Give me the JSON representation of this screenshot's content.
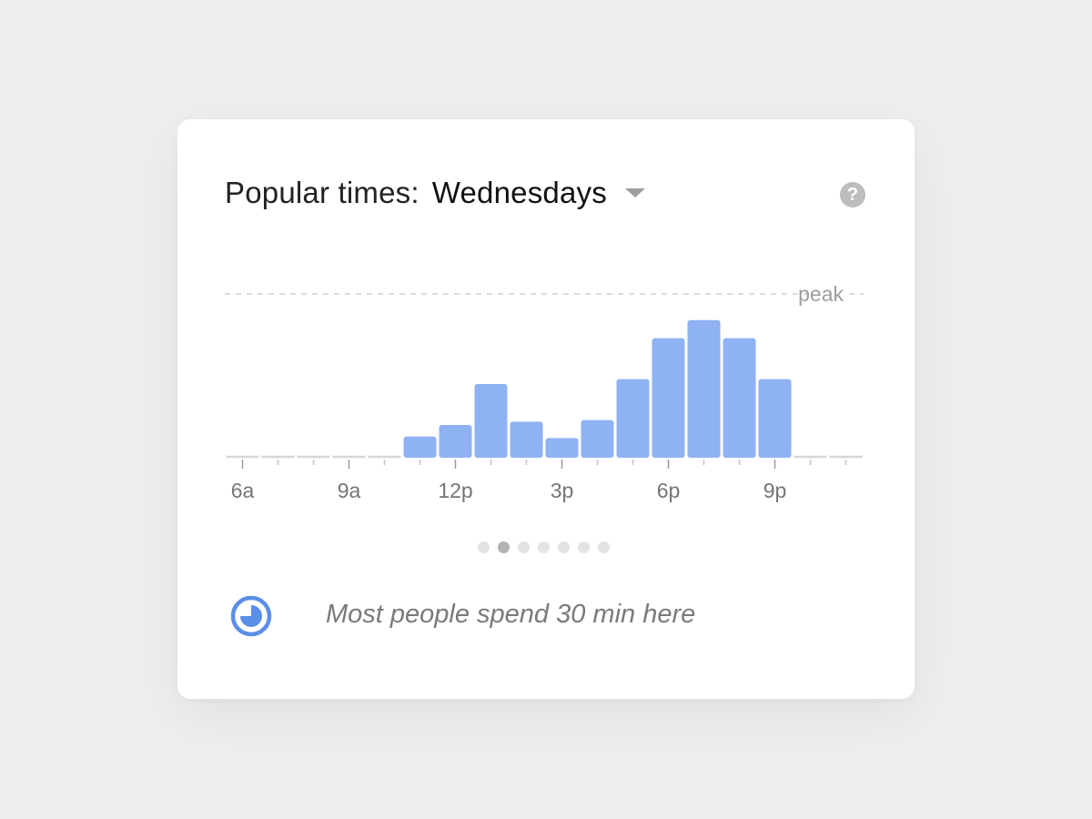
{
  "card": {
    "title_label": "Popular times:",
    "day": "Wednesdays",
    "caret_icon": "caret-down-icon",
    "help_icon": "help-circle-icon",
    "help_glyph": "?",
    "footer_icon": "clock-icon",
    "footer_text": "Most people spend 30 min here",
    "pager": {
      "count": 7,
      "active_index": 1
    }
  },
  "colors": {
    "bar": "#8fb2f2",
    "baseline": "#d6d6d6",
    "peak_line": "#cfcfcf",
    "tick_label": "#757575",
    "accent": "#5b8ee6"
  },
  "chart_data": {
    "type": "bar",
    "peak_label": "peak",
    "x_ticks": [
      "6a",
      "9a",
      "12p",
      "3p",
      "6p",
      "9p"
    ],
    "x_tick_hours": [
      6,
      9,
      12,
      15,
      18,
      21
    ],
    "hours": [
      6,
      7,
      8,
      9,
      10,
      11,
      12,
      13,
      14,
      15,
      16,
      17,
      18,
      19,
      20,
      21,
      22,
      23
    ],
    "values": [
      0,
      0,
      0,
      0,
      0,
      13,
      20,
      45,
      22,
      12,
      23,
      48,
      73,
      84,
      73,
      48,
      0,
      0
    ],
    "ylim": [
      0,
      100
    ],
    "grid": false
  }
}
